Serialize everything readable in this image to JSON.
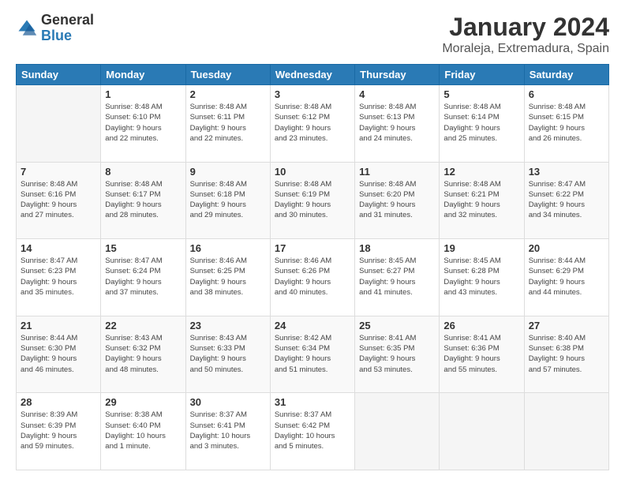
{
  "logo": {
    "general": "General",
    "blue": "Blue"
  },
  "title": "January 2024",
  "subtitle": "Moraleja, Extremadura, Spain",
  "days_header": [
    "Sunday",
    "Monday",
    "Tuesday",
    "Wednesday",
    "Thursday",
    "Friday",
    "Saturday"
  ],
  "weeks": [
    [
      {
        "day": "",
        "info": ""
      },
      {
        "day": "1",
        "info": "Sunrise: 8:48 AM\nSunset: 6:10 PM\nDaylight: 9 hours\nand 22 minutes."
      },
      {
        "day": "2",
        "info": "Sunrise: 8:48 AM\nSunset: 6:11 PM\nDaylight: 9 hours\nand 22 minutes."
      },
      {
        "day": "3",
        "info": "Sunrise: 8:48 AM\nSunset: 6:12 PM\nDaylight: 9 hours\nand 23 minutes."
      },
      {
        "day": "4",
        "info": "Sunrise: 8:48 AM\nSunset: 6:13 PM\nDaylight: 9 hours\nand 24 minutes."
      },
      {
        "day": "5",
        "info": "Sunrise: 8:48 AM\nSunset: 6:14 PM\nDaylight: 9 hours\nand 25 minutes."
      },
      {
        "day": "6",
        "info": "Sunrise: 8:48 AM\nSunset: 6:15 PM\nDaylight: 9 hours\nand 26 minutes."
      }
    ],
    [
      {
        "day": "7",
        "info": "Sunrise: 8:48 AM\nSunset: 6:16 PM\nDaylight: 9 hours\nand 27 minutes."
      },
      {
        "day": "8",
        "info": "Sunrise: 8:48 AM\nSunset: 6:17 PM\nDaylight: 9 hours\nand 28 minutes."
      },
      {
        "day": "9",
        "info": "Sunrise: 8:48 AM\nSunset: 6:18 PM\nDaylight: 9 hours\nand 29 minutes."
      },
      {
        "day": "10",
        "info": "Sunrise: 8:48 AM\nSunset: 6:19 PM\nDaylight: 9 hours\nand 30 minutes."
      },
      {
        "day": "11",
        "info": "Sunrise: 8:48 AM\nSunset: 6:20 PM\nDaylight: 9 hours\nand 31 minutes."
      },
      {
        "day": "12",
        "info": "Sunrise: 8:48 AM\nSunset: 6:21 PM\nDaylight: 9 hours\nand 32 minutes."
      },
      {
        "day": "13",
        "info": "Sunrise: 8:47 AM\nSunset: 6:22 PM\nDaylight: 9 hours\nand 34 minutes."
      }
    ],
    [
      {
        "day": "14",
        "info": "Sunrise: 8:47 AM\nSunset: 6:23 PM\nDaylight: 9 hours\nand 35 minutes."
      },
      {
        "day": "15",
        "info": "Sunrise: 8:47 AM\nSunset: 6:24 PM\nDaylight: 9 hours\nand 37 minutes."
      },
      {
        "day": "16",
        "info": "Sunrise: 8:46 AM\nSunset: 6:25 PM\nDaylight: 9 hours\nand 38 minutes."
      },
      {
        "day": "17",
        "info": "Sunrise: 8:46 AM\nSunset: 6:26 PM\nDaylight: 9 hours\nand 40 minutes."
      },
      {
        "day": "18",
        "info": "Sunrise: 8:45 AM\nSunset: 6:27 PM\nDaylight: 9 hours\nand 41 minutes."
      },
      {
        "day": "19",
        "info": "Sunrise: 8:45 AM\nSunset: 6:28 PM\nDaylight: 9 hours\nand 43 minutes."
      },
      {
        "day": "20",
        "info": "Sunrise: 8:44 AM\nSunset: 6:29 PM\nDaylight: 9 hours\nand 44 minutes."
      }
    ],
    [
      {
        "day": "21",
        "info": "Sunrise: 8:44 AM\nSunset: 6:30 PM\nDaylight: 9 hours\nand 46 minutes."
      },
      {
        "day": "22",
        "info": "Sunrise: 8:43 AM\nSunset: 6:32 PM\nDaylight: 9 hours\nand 48 minutes."
      },
      {
        "day": "23",
        "info": "Sunrise: 8:43 AM\nSunset: 6:33 PM\nDaylight: 9 hours\nand 50 minutes."
      },
      {
        "day": "24",
        "info": "Sunrise: 8:42 AM\nSunset: 6:34 PM\nDaylight: 9 hours\nand 51 minutes."
      },
      {
        "day": "25",
        "info": "Sunrise: 8:41 AM\nSunset: 6:35 PM\nDaylight: 9 hours\nand 53 minutes."
      },
      {
        "day": "26",
        "info": "Sunrise: 8:41 AM\nSunset: 6:36 PM\nDaylight: 9 hours\nand 55 minutes."
      },
      {
        "day": "27",
        "info": "Sunrise: 8:40 AM\nSunset: 6:38 PM\nDaylight: 9 hours\nand 57 minutes."
      }
    ],
    [
      {
        "day": "28",
        "info": "Sunrise: 8:39 AM\nSunset: 6:39 PM\nDaylight: 9 hours\nand 59 minutes."
      },
      {
        "day": "29",
        "info": "Sunrise: 8:38 AM\nSunset: 6:40 PM\nDaylight: 10 hours\nand 1 minute."
      },
      {
        "day": "30",
        "info": "Sunrise: 8:37 AM\nSunset: 6:41 PM\nDaylight: 10 hours\nand 3 minutes."
      },
      {
        "day": "31",
        "info": "Sunrise: 8:37 AM\nSunset: 6:42 PM\nDaylight: 10 hours\nand 5 minutes."
      },
      {
        "day": "",
        "info": ""
      },
      {
        "day": "",
        "info": ""
      },
      {
        "day": "",
        "info": ""
      }
    ]
  ]
}
